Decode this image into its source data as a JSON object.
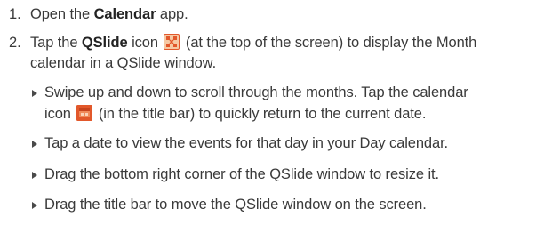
{
  "steps": [
    {
      "number": "1.",
      "pre": "Open the ",
      "bold": "Calendar",
      "post": " app."
    },
    {
      "number": "2.",
      "pre": "Tap the ",
      "bold": "QSlide",
      "mid": " icon ",
      "icon": "qslide-icon",
      "post": " (at the top of the screen) to display the Month",
      "line2": "calendar in a QSlide window."
    }
  ],
  "bullets": [
    {
      "line1": "Swipe up and down to scroll through the months. Tap the calendar",
      "line2_pre": "icon ",
      "icon": "calendar-icon",
      "line2_post": " (in the title bar) to quickly return to the current date."
    },
    {
      "text": "Tap a date to view the events for that day in your Day calendar."
    },
    {
      "text": "Drag the bottom right corner of the QSlide window to resize it."
    },
    {
      "text": "Drag the title bar to move the QSlide window on the screen."
    }
  ],
  "colors": {
    "text": "#3a3a3a",
    "icon_accent": "#e2582b",
    "icon_light": "#f6c9a4"
  }
}
